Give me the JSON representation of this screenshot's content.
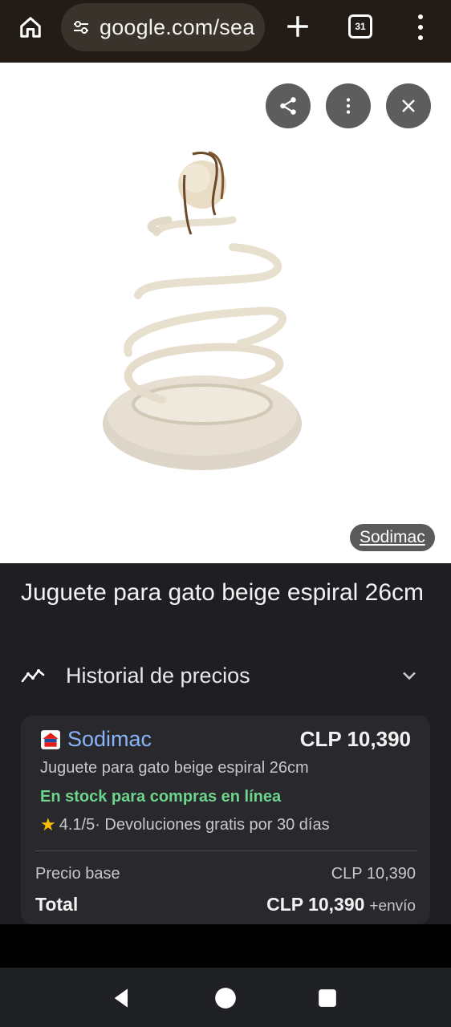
{
  "browser": {
    "url": "google.com/sea",
    "tab_count": "31"
  },
  "image": {
    "source_label": "Sodimac"
  },
  "product": {
    "title": "Juguete para gato beige espiral 26cm"
  },
  "price_history": {
    "label": "Historial de precios"
  },
  "offer": {
    "store_name": "Sodimac",
    "price": "CLP 10,390",
    "description": "Juguete para gato beige espiral 26cm",
    "stock": "En stock para compras en línea",
    "rating": "4.1/5",
    "rating_extra": " · Devoluciones gratis por 30 días",
    "base_label": "Precio base",
    "base_value": "CLP 10,390",
    "total_label": "Total",
    "total_value": "CLP 10,390",
    "shipping": "+envío"
  },
  "colors": {
    "link": "#8ab4f8",
    "stock_green": "#6dd58c",
    "star": "#fbbc04"
  }
}
